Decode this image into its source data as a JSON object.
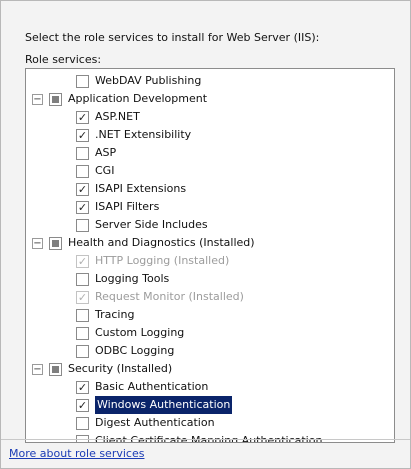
{
  "instruction": "Select the role services to install for Web Server (IIS):",
  "role_services_label": "Role services:",
  "tree": [
    {
      "label": "WebDAV Publishing",
      "level": 2,
      "checked": "unchecked"
    },
    {
      "label": "Application Development",
      "level": 1,
      "checked": "tri",
      "expander": "-"
    },
    {
      "label": "ASP.NET",
      "level": 2,
      "checked": "checked"
    },
    {
      "label": ".NET Extensibility",
      "level": 2,
      "checked": "checked"
    },
    {
      "label": "ASP",
      "level": 2,
      "checked": "unchecked"
    },
    {
      "label": "CGI",
      "level": 2,
      "checked": "unchecked"
    },
    {
      "label": "ISAPI Extensions",
      "level": 2,
      "checked": "checked"
    },
    {
      "label": "ISAPI Filters",
      "level": 2,
      "checked": "checked"
    },
    {
      "label": "Server Side Includes",
      "level": 2,
      "checked": "unchecked"
    },
    {
      "label": "Health and Diagnostics  (Installed)",
      "level": 1,
      "checked": "tri",
      "expander": "-"
    },
    {
      "label": "HTTP Logging  (Installed)",
      "level": 2,
      "checked": "checked-disabled",
      "dim": true
    },
    {
      "label": "Logging Tools",
      "level": 2,
      "checked": "unchecked"
    },
    {
      "label": "Request Monitor  (Installed)",
      "level": 2,
      "checked": "checked-disabled",
      "dim": true
    },
    {
      "label": "Tracing",
      "level": 2,
      "checked": "unchecked"
    },
    {
      "label": "Custom Logging",
      "level": 2,
      "checked": "unchecked"
    },
    {
      "label": "ODBC Logging",
      "level": 2,
      "checked": "unchecked"
    },
    {
      "label": "Security  (Installed)",
      "level": 1,
      "checked": "tri",
      "expander": "-"
    },
    {
      "label": "Basic Authentication",
      "level": 2,
      "checked": "checked"
    },
    {
      "label": "Windows Authentication",
      "level": 2,
      "checked": "checked",
      "selected": true
    },
    {
      "label": "Digest Authentication",
      "level": 2,
      "checked": "unchecked"
    },
    {
      "label": "Client Certificate Mapping Authentication",
      "level": 2,
      "checked": "unchecked"
    }
  ],
  "more_link": "More about role services"
}
